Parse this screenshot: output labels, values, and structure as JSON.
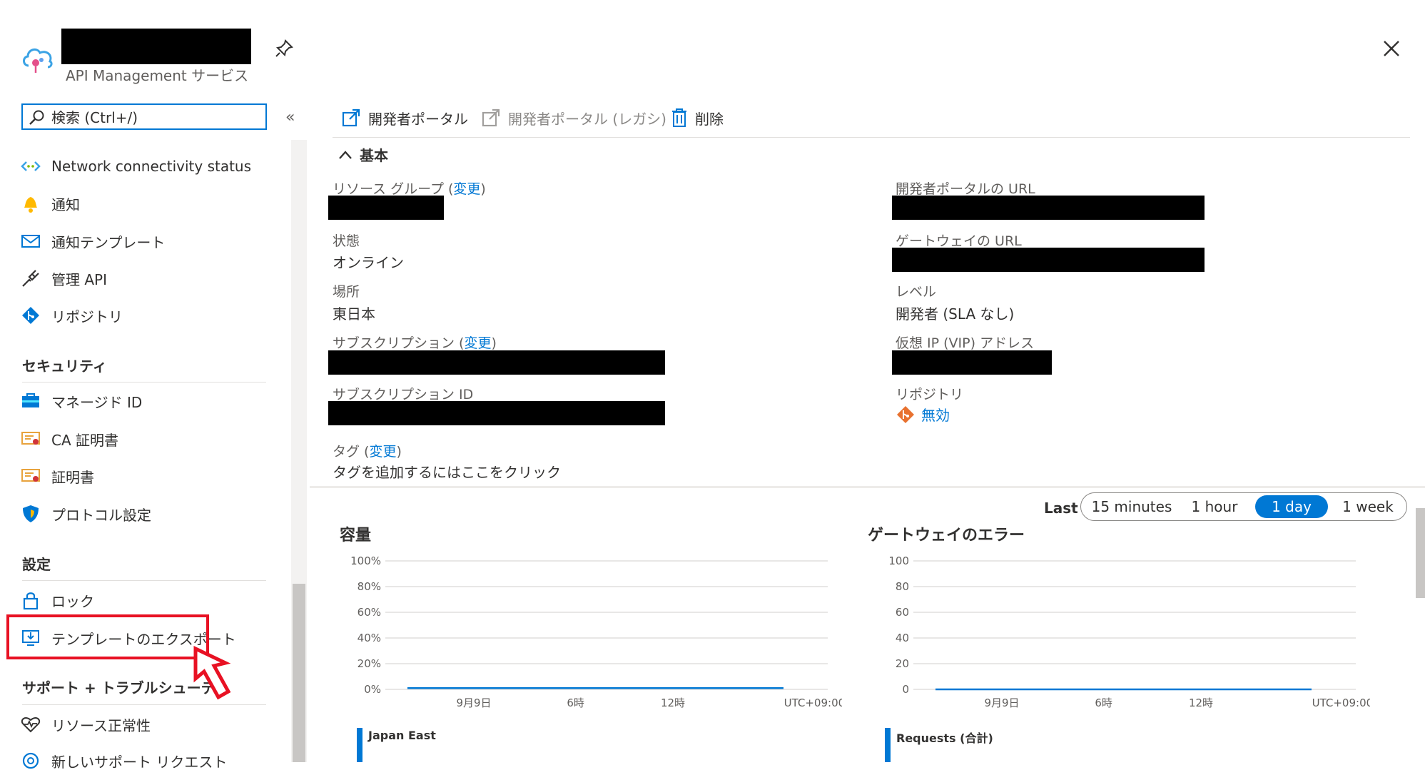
{
  "header": {
    "service_type": "API Management サービス"
  },
  "sidebar": {
    "search_placeholder": "検索 (Ctrl+/)",
    "items_top": [
      {
        "label": "Network connectivity status",
        "icon": "network-icon"
      },
      {
        "label": "通知",
        "icon": "bell-icon"
      },
      {
        "label": "通知テンプレート",
        "icon": "mail-icon"
      },
      {
        "label": "管理 API",
        "icon": "plug-icon"
      },
      {
        "label": "リポジトリ",
        "icon": "git-icon"
      }
    ],
    "section_security": "セキュリティ",
    "items_security": [
      {
        "label": "マネージド ID",
        "icon": "managed-id-icon"
      },
      {
        "label": "CA 証明書",
        "icon": "certificate-icon"
      },
      {
        "label": "証明書",
        "icon": "certificate-icon"
      },
      {
        "label": "プロトコル設定",
        "icon": "shield-icon"
      }
    ],
    "section_settings": "設定",
    "items_settings": [
      {
        "label": "ロック",
        "icon": "lock-icon"
      },
      {
        "label": "テンプレートのエクスポート",
        "icon": "export-template-icon"
      }
    ],
    "section_support": "サポート + トラブルシューティング",
    "items_support": [
      {
        "label": "リソース正常性",
        "icon": "heart-icon"
      },
      {
        "label": "新しいサポート リクエスト",
        "icon": "support-icon"
      }
    ]
  },
  "toolbar": {
    "dev_portal": "開発者ポータル",
    "dev_portal_legacy": "開発者ポータル (レガシ)",
    "delete": "削除"
  },
  "essentials": {
    "heading": "基本",
    "change": "変更",
    "resource_group_label": "リソース グループ",
    "state_label": "状態",
    "state_value": "オンライン",
    "location_label": "場所",
    "location_value": "東日本",
    "subscription_label": "サブスクリプション",
    "subscription_id_label": "サブスクリプション ID",
    "tags_label": "タグ",
    "tags_add": "タグを追加するにはここをクリック",
    "dev_portal_url_label": "開発者ポータルの URL",
    "gateway_url_label": "ゲートウェイの URL",
    "tier_label": "レベル",
    "tier_value": "開発者 (SLA なし)",
    "vip_label": "仮想 IP (VIP) アドレス",
    "repository_label": "リポジトリ",
    "repository_value": "無効"
  },
  "time_range": {
    "label": "Last",
    "options": [
      "15 minutes",
      "1 hour",
      "1 day",
      "1 week"
    ],
    "selected": "1 day"
  },
  "chart_data": [
    {
      "type": "line",
      "title": "容量",
      "yticks": [
        "100%",
        "80%",
        "60%",
        "40%",
        "20%",
        "0%"
      ],
      "xticks": [
        "9月9日",
        "6時",
        "12時",
        "UTC+09:00"
      ],
      "ylim": [
        0,
        100
      ],
      "series": [
        {
          "name": "Japan East",
          "values": [
            1,
            1,
            1,
            1,
            1,
            1,
            1,
            1,
            1,
            1,
            1,
            1,
            1,
            1,
            1,
            1,
            1,
            1,
            1,
            1
          ]
        }
      ]
    },
    {
      "type": "line",
      "title": "ゲートウェイのエラー",
      "yticks": [
        "100",
        "80",
        "60",
        "40",
        "20",
        "0"
      ],
      "xticks": [
        "9月9日",
        "6時",
        "12時",
        "UTC+09:00"
      ],
      "ylim": [
        0,
        100
      ],
      "series": [
        {
          "name": "Requests (合計)",
          "values": [
            0,
            0,
            0,
            0,
            0,
            0,
            0,
            0,
            0,
            0,
            0,
            0,
            0,
            0,
            0,
            0,
            0,
            0,
            0,
            0
          ]
        }
      ]
    }
  ]
}
